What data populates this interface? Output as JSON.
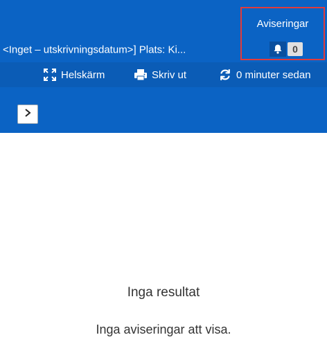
{
  "header": {
    "patient_info": "<Inget – utskrivningsdatum>] Plats: Ki...",
    "notifications": {
      "title": "Aviseringar",
      "count": "0"
    }
  },
  "toolbar": {
    "fullscreen_label": "Helskärm",
    "print_label": "Skriv ut",
    "refresh_label": "0 minuter sedan"
  },
  "empty_state": {
    "title": "Inga resultat",
    "message": "Inga aviseringar att visa."
  },
  "icons": [
    "expand-icon",
    "printer-icon",
    "refresh-icon",
    "bell-icon",
    "chevron-right-icon"
  ],
  "colors": {
    "header_blue": "#0b63c4",
    "toolbar_blue": "#0b5cb6",
    "highlight_red": "#e23b3b"
  }
}
